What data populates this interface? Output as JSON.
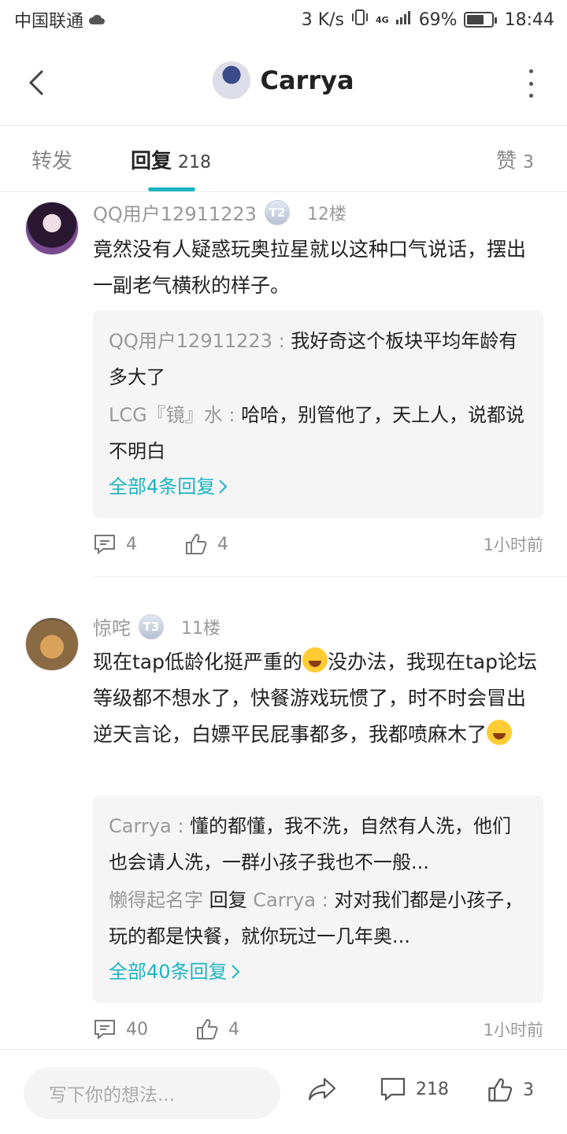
{
  "status_bar": {
    "carrier": "中国联通",
    "speed": "3 K/s",
    "signal": "4G",
    "battery": "69%",
    "battery_level": 0.69,
    "time": "18:44"
  },
  "header": {
    "title": "Carrya"
  },
  "tabs": [
    {
      "label": "转发",
      "count": ""
    },
    {
      "label": "回复",
      "count": "218"
    },
    {
      "label": "赞",
      "count": "3"
    }
  ],
  "posts": [
    {
      "user": "QQ用户12911223",
      "level": "T2",
      "floor": "12楼",
      "body": "竟然没有人疑惑玩奥拉星就以这种口气说话，摆出一副老气横秋的样子。",
      "quotes": [
        {
          "name": "QQ用户12911223",
          "reply_to": "",
          "text": "我好奇这个板块平均年龄有多大了"
        },
        {
          "name": "LCG『镜』水",
          "reply_to": "",
          "text": "哈哈，别管他了，天上人，说都说不明白"
        }
      ],
      "all_replies": "全部4条回复",
      "comments": "4",
      "likes": "4",
      "time": "1小时前"
    },
    {
      "user": "惊咤",
      "level": "T3",
      "floor": "11楼",
      "body_parts": [
        "现在tap低龄化挺严重的",
        "没办法，我现在tap论坛等级都不想水了，快餐游戏玩惯了，时不时会冒出逆天言论，白嫖平民屁事都多，我都喷麻木了"
      ],
      "emoji": "laughing-crying-emoji",
      "quotes": [
        {
          "name": "Carrya",
          "reply_to": "",
          "text": "懂的都懂，我不洗，自然有人洗，他们也会请人洗，一群小孩子我也不一般..."
        },
        {
          "name": "懒得起名字",
          "reply_word": "回复",
          "reply_to": "Carrya",
          "text": "对对我们都是小孩子，玩的都是快餐，就你玩过一几年奥..."
        }
      ],
      "all_replies": "全部40条回复",
      "comments": "40",
      "likes": "4",
      "time": "1小时前"
    }
  ],
  "bottom_bar": {
    "placeholder": "写下你的想法...",
    "comment_count": "218",
    "like_count": "3"
  },
  "colors": {
    "accent": "#1cb5c2",
    "muted": "#999999"
  }
}
